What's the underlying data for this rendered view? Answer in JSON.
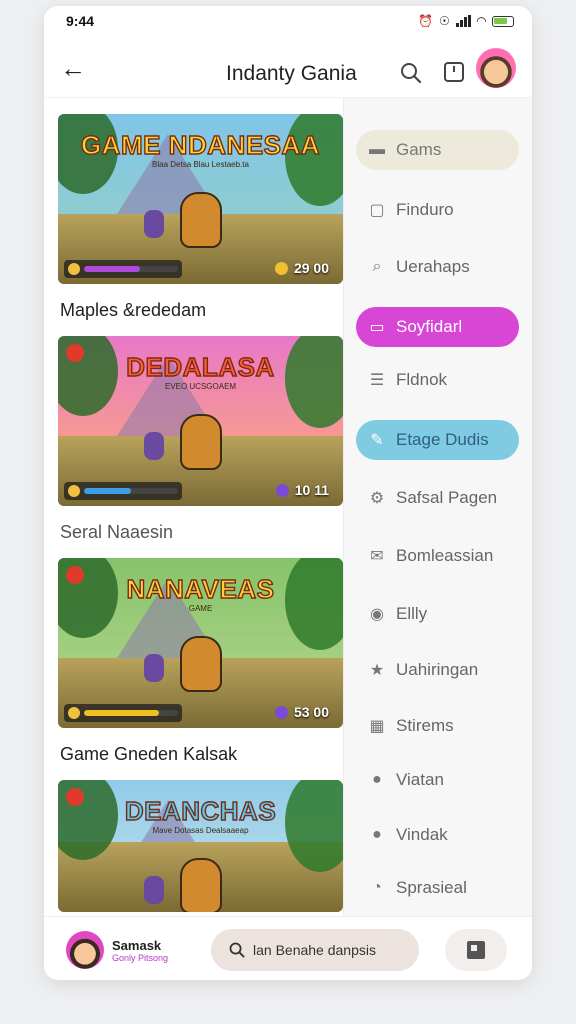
{
  "status": {
    "time": "9:44"
  },
  "header": {
    "title": "Indanty Gania"
  },
  "feed": [
    {
      "thumb_title": "GAME NDANESAA",
      "thumb_sub": "Blaa Detsa Blau Lestaeb.ta",
      "score": "29 00",
      "label": "Maples &rededam",
      "sky": [
        "#7fc5e8",
        "#9ad2c0"
      ],
      "title_color": "#ffd43a",
      "bar_color": "#b04ad8",
      "bar_level": 0.6,
      "coin_color": "#f0c030",
      "badge": false
    },
    {
      "thumb_title": "DEDALASA",
      "thumb_sub": "EVEO UCSGOAEM",
      "score": "10 11",
      "label": "Seral Naaesin",
      "sky": [
        "#e878c8",
        "#ffb070"
      ],
      "title_color": "#ff5a3a",
      "bar_color": "#3a9ee8",
      "bar_level": 0.5,
      "coin_color": "#7a4ad8",
      "badge": true
    },
    {
      "thumb_title": "NANAVEAS",
      "thumb_sub": "GAME",
      "score": "53 00",
      "label": "Game Gneden Kalsak",
      "sky": [
        "#86c36a",
        "#b8d890"
      ],
      "title_color": "#ffd43a",
      "bar_color": "#f0c020",
      "bar_level": 0.8,
      "coin_color": "#7a4ad8",
      "badge": true
    },
    {
      "thumb_title": "DEANCHAS",
      "thumb_sub": "Mave Dotasas Dealsaaeap",
      "score": "",
      "label": "",
      "sky": [
        "#8fcbe8",
        "#c5e3ef"
      ],
      "title_color": "#5ac8f0",
      "bar_color": "#ffffff",
      "bar_level": 0,
      "coin_color": "#ffffff",
      "badge": true
    }
  ],
  "sidebar": [
    {
      "label": "Gams",
      "icon": "folder-icon",
      "glyph": "▬",
      "style": "active-beige"
    },
    {
      "label": "Finduro",
      "icon": "document-icon",
      "glyph": "▢",
      "style": ""
    },
    {
      "label": "Uerahaps",
      "icon": "search-icon",
      "glyph": "⌕",
      "style": ""
    },
    {
      "label": "Soyfidarl",
      "icon": "square-icon",
      "glyph": "▭",
      "style": "active-pink"
    },
    {
      "label": "Fldnok",
      "icon": "card-icon",
      "glyph": "☰",
      "style": ""
    },
    {
      "label": "Etage Dudis",
      "icon": "edit-icon",
      "glyph": "✎",
      "style": "active-blue"
    },
    {
      "label": "Safsal Pagen",
      "icon": "gear-icon",
      "glyph": "⚙",
      "style": ""
    },
    {
      "label": "Bomleassian",
      "icon": "mail-icon",
      "glyph": "✉",
      "style": ""
    },
    {
      "label": "Ellly",
      "icon": "magnify-icon",
      "glyph": "◉",
      "style": ""
    },
    {
      "label": "Uahiringan",
      "icon": "star-icon",
      "glyph": "★",
      "style": ""
    },
    {
      "label": "Stirems",
      "icon": "grid-icon",
      "glyph": "▦",
      "style": ""
    },
    {
      "label": "Viatan",
      "icon": "info-icon",
      "glyph": "●",
      "style": ""
    },
    {
      "label": "Vindak",
      "icon": "help-icon",
      "glyph": "●",
      "style": ""
    },
    {
      "label": "Sprasieal",
      "icon": "clock-icon",
      "glyph": "◔",
      "style": ""
    }
  ],
  "bottom": {
    "user_name": "Samask",
    "user_sub": "Gonly Pitsong",
    "search_text": "lan Benahe danpsis"
  }
}
